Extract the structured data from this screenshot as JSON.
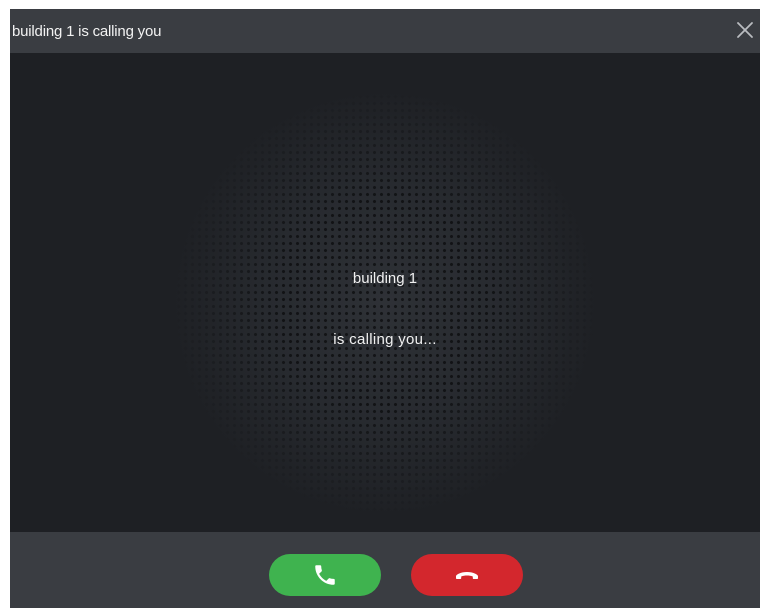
{
  "window": {
    "title": "building 1 is calling you",
    "close_icon": "close-icon"
  },
  "call": {
    "caller_name": "building 1",
    "status_text": "is calling you..."
  },
  "actions": {
    "answer_icon": "phone-answer-icon",
    "decline_icon": "phone-hangup-icon",
    "answer_color": "#3fb34f",
    "decline_color": "#d3272d"
  },
  "colors": {
    "titlebar_bg": "#3a3d42",
    "stage_bg": "#1e2024"
  }
}
